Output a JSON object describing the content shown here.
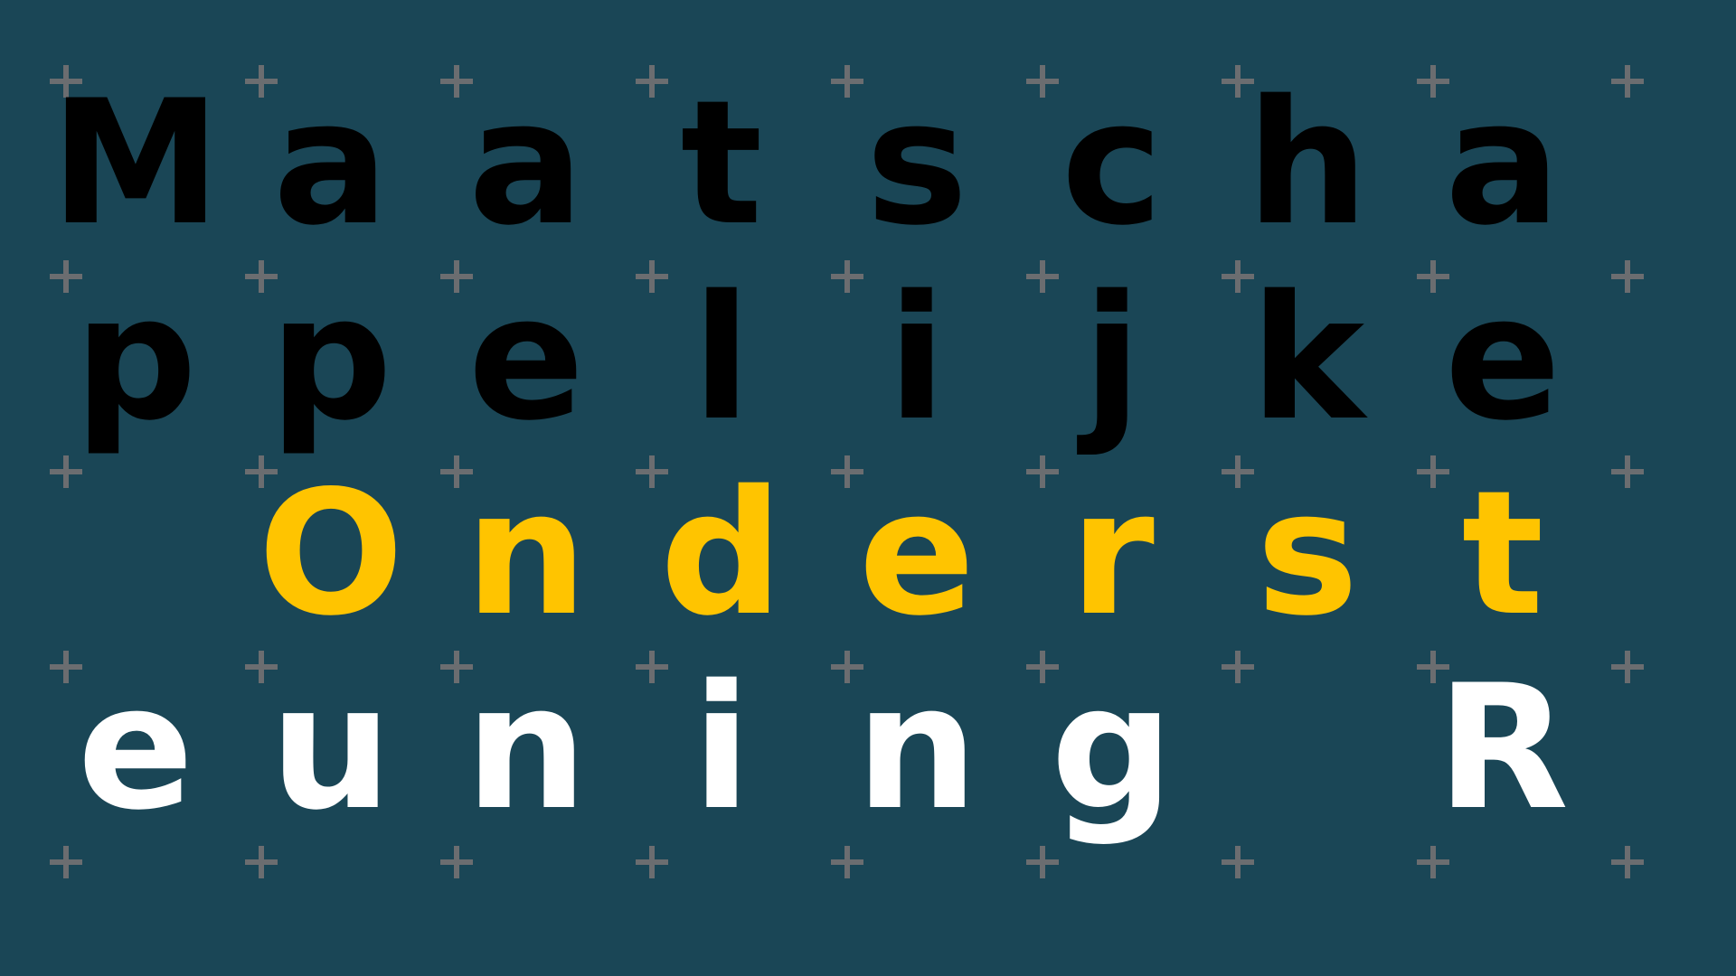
{
  "colors": {
    "background": "#1a4656",
    "grid_marker": "#6b6d70",
    "row_colors": [
      "#000000",
      "#000000",
      "#ffc400",
      "#ffffff"
    ]
  },
  "grid_marker_icon": "plus-icon",
  "rows": [
    [
      "M",
      "a",
      "a",
      "t",
      "s",
      "c",
      "h",
      "a"
    ],
    [
      "p",
      "p",
      "e",
      "l",
      "i",
      "j",
      "k",
      "e"
    ],
    [
      "",
      "O",
      "n",
      "d",
      "e",
      "r",
      "s",
      "t"
    ],
    [
      "e",
      "u",
      "n",
      "i",
      "n",
      "g",
      "",
      "R"
    ]
  ]
}
